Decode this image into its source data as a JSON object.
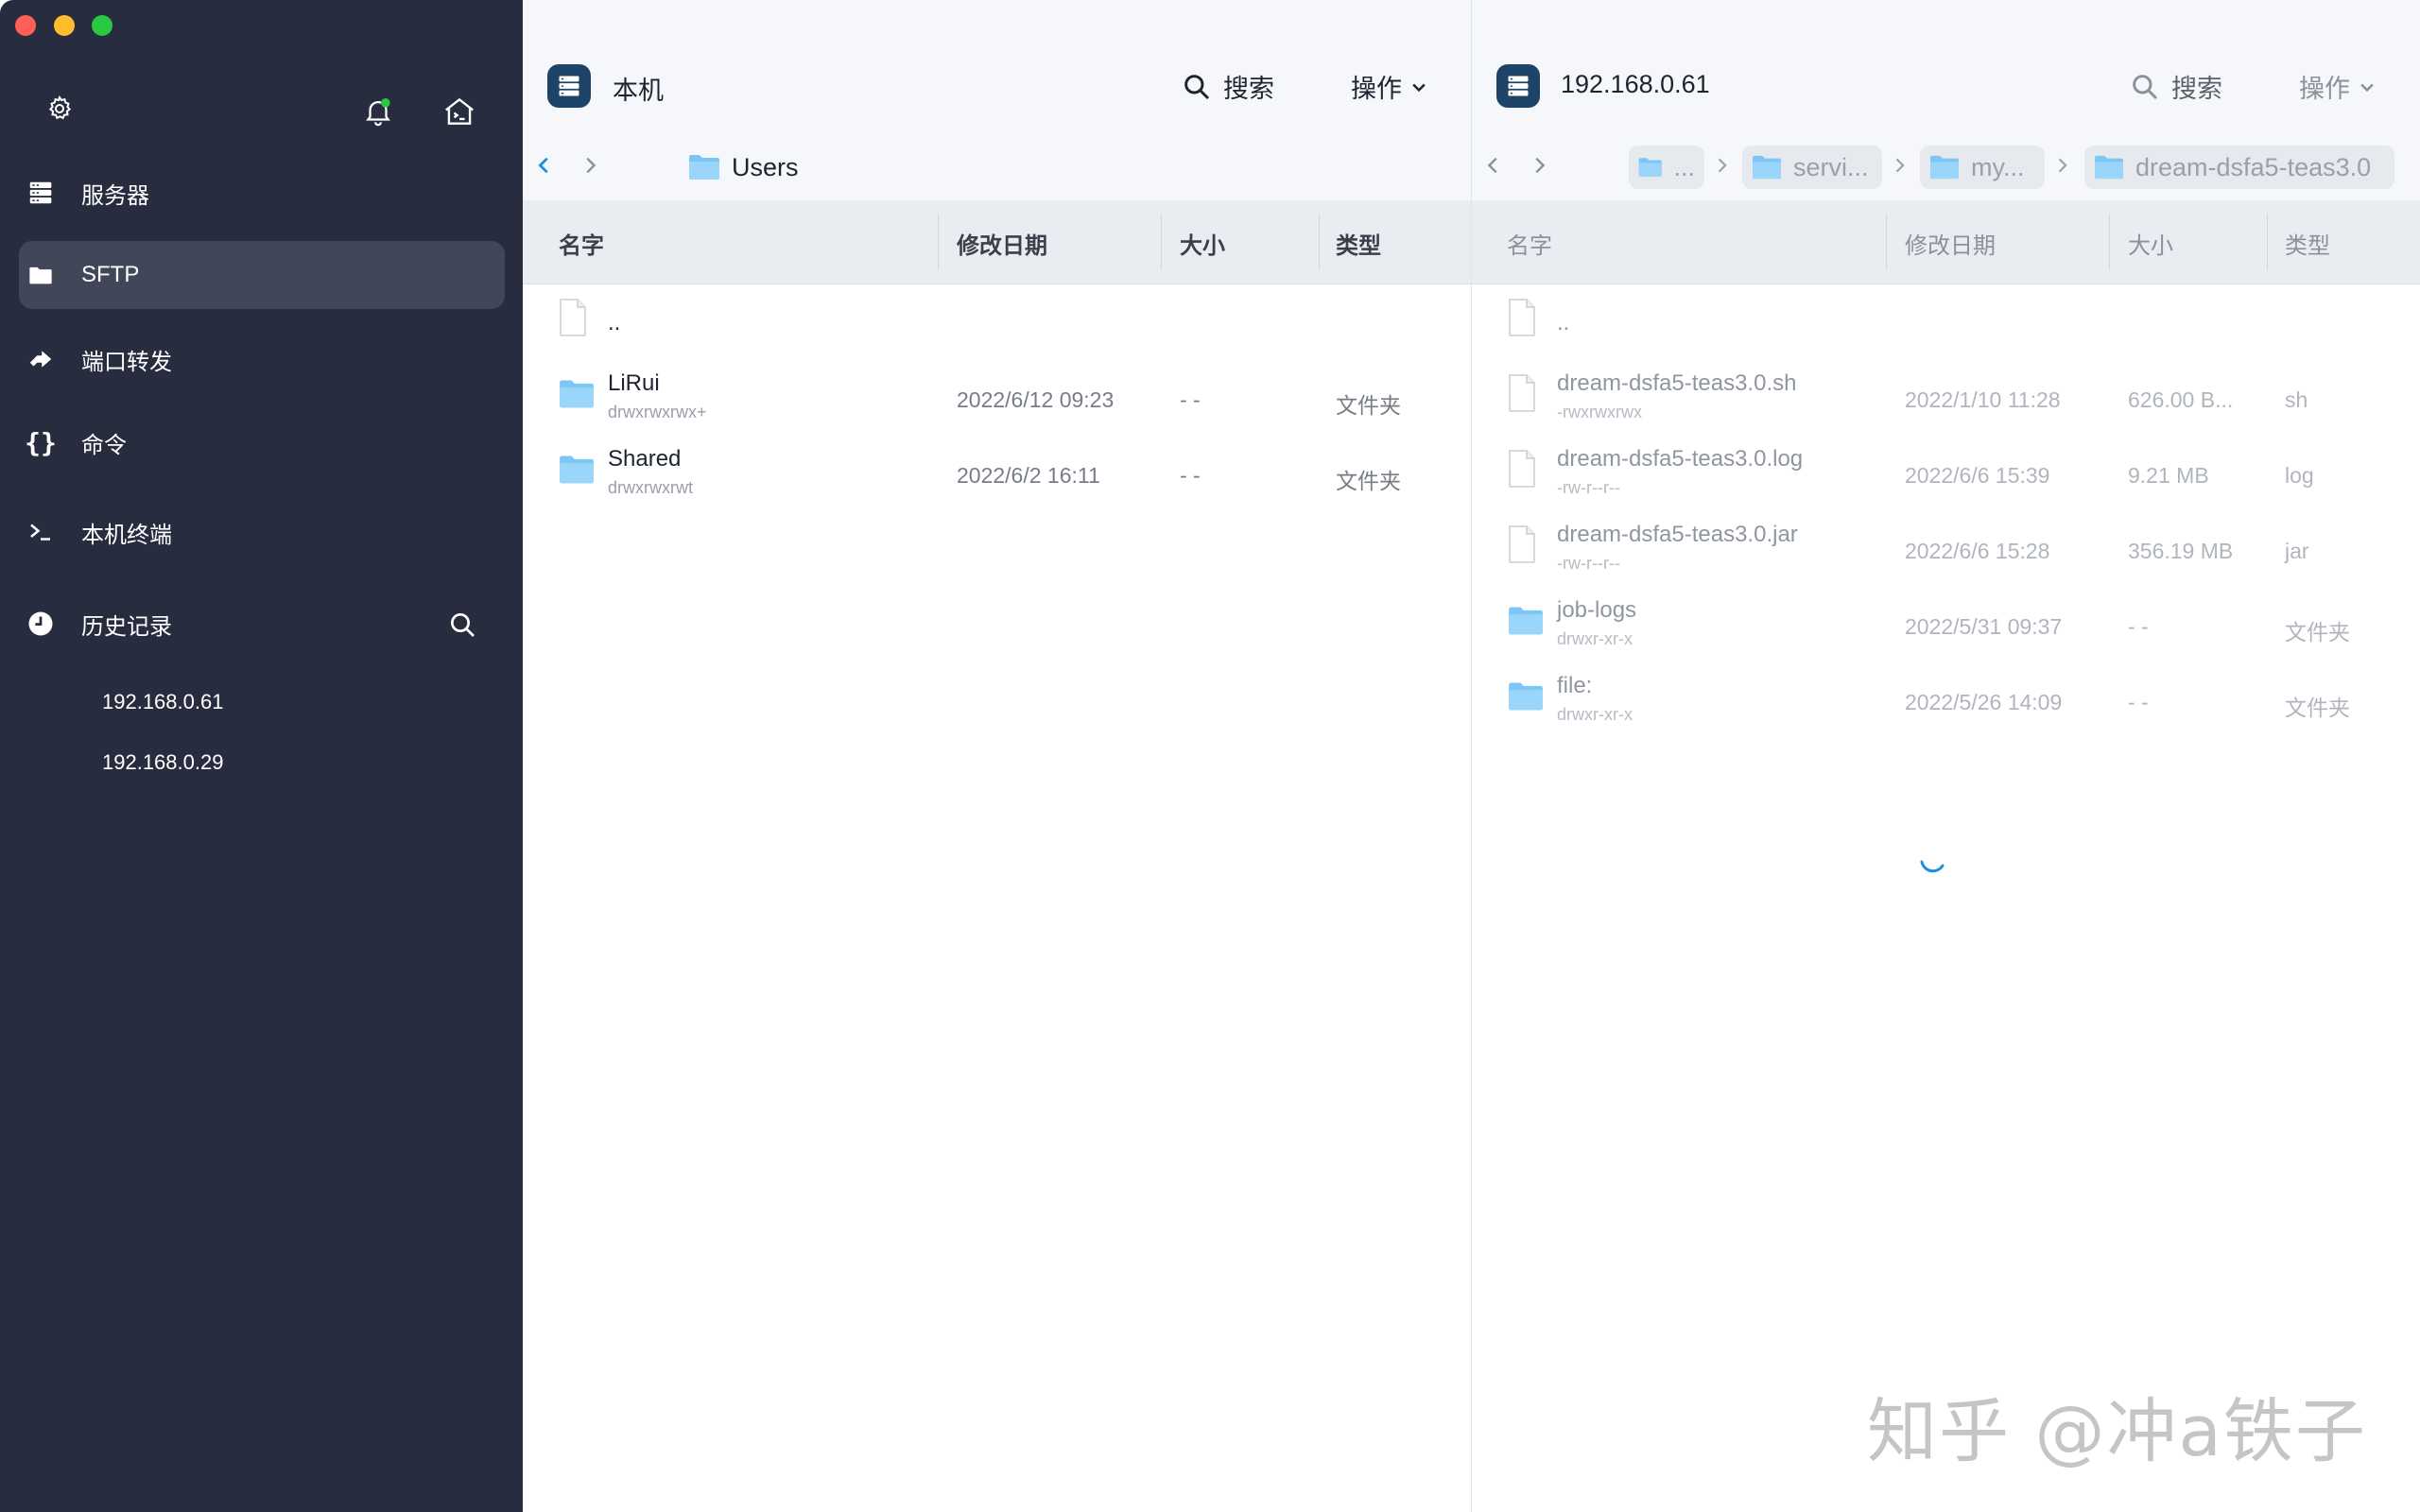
{
  "sidebar": {
    "nav": [
      {
        "label": "服务器",
        "icon": "server-icon"
      },
      {
        "label": "SFTP",
        "icon": "folder-icon"
      },
      {
        "label": "端口转发",
        "icon": "port-forward-icon"
      },
      {
        "label": "命令",
        "icon": "braces-icon"
      },
      {
        "label": "本机终端",
        "icon": "terminal-icon"
      },
      {
        "label": "历史记录",
        "icon": "clock-icon"
      }
    ],
    "active": "SFTP",
    "history": [
      "192.168.0.61",
      "192.168.0.29"
    ],
    "notification_dot_color": "#28c840"
  },
  "local": {
    "title": "本机",
    "search_label": "搜索",
    "ops_label": "操作",
    "path": [
      "Users"
    ],
    "columns": [
      "名字",
      "修改日期",
      "大小",
      "类型"
    ],
    "rows": [
      {
        "name": "..",
        "perm": "",
        "date": "",
        "size": "",
        "type": "",
        "kind": "file"
      },
      {
        "name": "LiRui",
        "perm": "drwxrwxrwx+",
        "date": "2022/6/12 09:23",
        "size": "- -",
        "type": "文件夹",
        "kind": "folder"
      },
      {
        "name": "Shared",
        "perm": "drwxrwxrwt",
        "date": "2022/6/2 16:11",
        "size": "- -",
        "type": "文件夹",
        "kind": "folder"
      }
    ]
  },
  "remote": {
    "title": "192.168.0.61",
    "search_label": "搜索",
    "ops_label": "操作",
    "path": [
      "...",
      "servi...",
      "my...",
      "dream-dsfa5-teas3.0"
    ],
    "columns": [
      "名字",
      "修改日期",
      "大小",
      "类型"
    ],
    "rows": [
      {
        "name": "..",
        "perm": "",
        "date": "",
        "size": "",
        "type": "",
        "kind": "file"
      },
      {
        "name": "dream-dsfa5-teas3.0.sh",
        "perm": "-rwxrwxrwx",
        "date": "2022/1/10 11:28",
        "size": "626.00 B...",
        "type": "sh",
        "kind": "file"
      },
      {
        "name": "dream-dsfa5-teas3.0.log",
        "perm": "-rw-r--r--",
        "date": "2022/6/6 15:39",
        "size": "9.21 MB",
        "type": "log",
        "kind": "file"
      },
      {
        "name": "dream-dsfa5-teas3.0.jar",
        "perm": "-rw-r--r--",
        "date": "2022/6/6 15:28",
        "size": "356.19 MB",
        "type": "jar",
        "kind": "file"
      },
      {
        "name": "job-logs",
        "perm": "drwxr-xr-x",
        "date": "2022/5/31 09:37",
        "size": "- -",
        "type": "文件夹",
        "kind": "folder"
      },
      {
        "name": "file:",
        "perm": "drwxr-xr-x",
        "date": "2022/5/26 14:09",
        "size": "- -",
        "type": "文件夹",
        "kind": "folder"
      }
    ],
    "loading": true
  },
  "watermark": "知乎 @冲a铁子",
  "colors": {
    "sidebar_bg": "#282c3f",
    "accent_blue": "#1a8fe0",
    "host_badge": "#1d4467",
    "folder": "#7cc6f5"
  }
}
